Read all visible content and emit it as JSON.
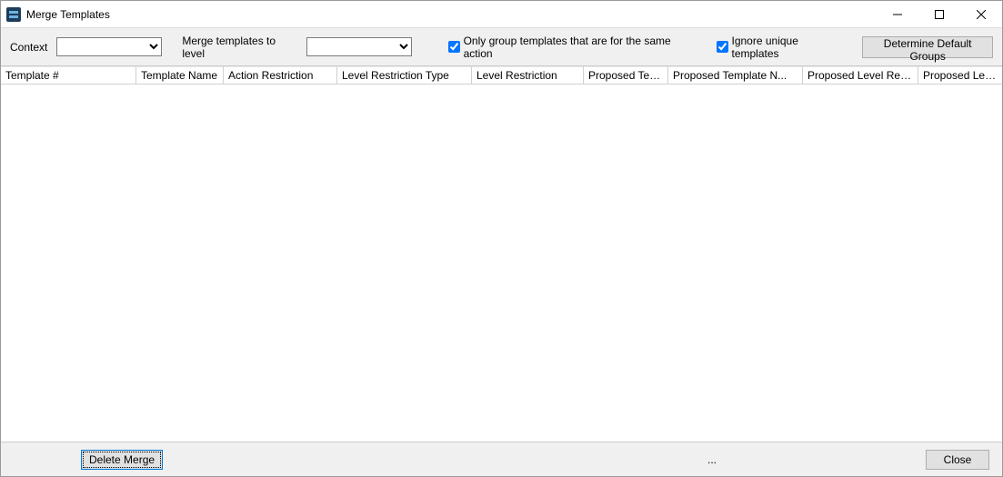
{
  "titlebar": {
    "title": "Merge Templates"
  },
  "toolbar": {
    "context_label": "Context",
    "context_value": "",
    "merge_level_label": "Merge templates to level",
    "merge_level_value": "",
    "only_same_action_label": "Only group templates that are for the same action",
    "ignore_unique_label": "Ignore unique templates",
    "determine_label": "Determine Default Groups"
  },
  "table": {
    "columns": [
      "Template #",
      "Template Name",
      "Action Restriction",
      "Level Restriction Type",
      "Level Restriction",
      "Proposed Template #",
      "Proposed Template N...",
      "Proposed Level Restri...",
      "Proposed Level Restri..."
    ]
  },
  "footer": {
    "delete_label": "Delete Merge",
    "ellipsis": "...",
    "close_label": "Close"
  }
}
